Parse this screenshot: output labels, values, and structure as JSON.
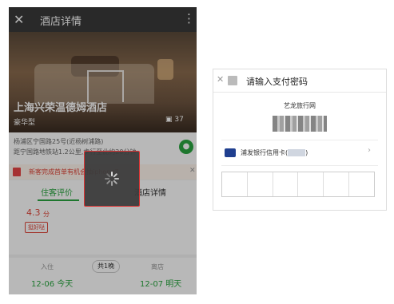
{
  "phone": {
    "title": "酒店详情",
    "hotel_name": "上海兴荣温德姆酒店",
    "room_type": "豪华型",
    "photo_count": "37",
    "address_line1": "杨浦区宁国路25号(近杨树浦路)",
    "address_line2": "距宁国路地铁站1.2公里,步行至此约20分钟",
    "promo_text": "新客完成首单有机会抽iphone7",
    "tabs": {
      "reviews": "住客评价",
      "details": "酒店详情"
    },
    "score": "4.3",
    "score_unit": "分",
    "good_badge": "挺好哒",
    "checkin_label": "入住",
    "checkout_label": "离店",
    "nights": "共1晚",
    "checkin_date": "12-06 今天",
    "checkout_date": "12-07 明天",
    "icons": {
      "close": "close-icon",
      "menu": "more-vertical-icon",
      "camera": "camera-icon",
      "map": "map-pin-icon",
      "spinner": "loading-spinner-icon"
    }
  },
  "payment": {
    "title": "请输入支付密码",
    "merchant": "艺龙旅行网",
    "bank_label": "浦发银行信用卡(",
    "bank_suffix": ")",
    "pin_cells": 6,
    "icons": {
      "close": "close-icon",
      "bank": "bank-logo-icon",
      "chevron": "chevron-right-icon"
    }
  },
  "colors": {
    "accent_green": "#2aa640",
    "accent_red": "#e0463a",
    "topbar": "#3a3a3a"
  }
}
